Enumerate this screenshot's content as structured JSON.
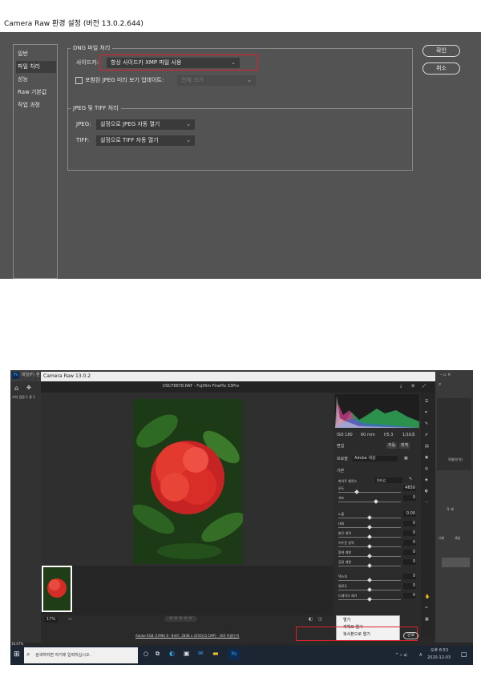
{
  "dialog": {
    "title": "Camera Raw 환경 설정  (버전 13.0.2.644)",
    "sidebar": [
      {
        "label": "일반",
        "selected": false
      },
      {
        "label": "파일 처리",
        "selected": true
      },
      {
        "label": "성능",
        "selected": false
      },
      {
        "label": "Raw 기본값",
        "selected": false
      },
      {
        "label": "작업 과정",
        "selected": false
      }
    ],
    "dng": {
      "group_title": "DNG 파일 처리",
      "sidecar_label": "사이드카:",
      "sidecar_value": "항상 사이드카 XMP 파일 사용",
      "embedded_label": "포함된 JPEG 미리 보기 업데이트:",
      "embedded_checked": false,
      "embedded_value": "전체 크기"
    },
    "jpeg_tiff": {
      "group_title": "JPEG 및 TIFF 처리",
      "jpeg_label": "JPEG:",
      "jpeg_value": "설정으로 JPEG 자동 열기",
      "tiff_label": "TIFF:",
      "tiff_value": "설정으로 TIFF 자동 열기"
    },
    "ok_label": "확인",
    "cancel_label": "취소",
    "highlight_color": "#e0202a"
  },
  "screenshot": {
    "ps_menu": {
      "logo": "Ps",
      "file_menu": "파일(F)",
      "edit_menu": "편"
    },
    "ps_doc_tab": "기저 검증-1 용 1",
    "cr_window_title": "Camera Raw 13.0.2",
    "file_name": "DSCF8878.RAF  -  Fujifilm FinePix S3Pro",
    "camera_info": {
      "iso": "ISO 180",
      "focal": "60 mm",
      "aperture": "f/5.3",
      "shutter": "1/16초"
    },
    "edit_label": "편집",
    "auto_label": "자동",
    "bw_label": "흑백",
    "profile_label": "프로필",
    "profile_value": "Adobe 색상",
    "basic_section": "기본",
    "wb_label": "화이트 밸런스",
    "wb_value": "원본값",
    "sliders": [
      {
        "label": "온도",
        "value": "4650",
        "pos": 0.3
      },
      {
        "label": "색조",
        "value": "0",
        "pos": 0.6
      },
      {
        "label": "노출",
        "value": "0.00",
        "pos": 0.5
      },
      {
        "label": "대비",
        "value": "0",
        "pos": 0.5
      },
      {
        "label": "밝은 영역",
        "value": "0",
        "pos": 0.5
      },
      {
        "label": "어두운 영역",
        "value": "0",
        "pos": 0.5
      },
      {
        "label": "흰색 계열",
        "value": "0",
        "pos": 0.5
      },
      {
        "label": "검정 계열",
        "value": "0",
        "pos": 0.5
      },
      {
        "label": "텍스처",
        "value": "0",
        "pos": 0.5
      },
      {
        "label": "명료도",
        "value": "0",
        "pos": 0.5
      },
      {
        "label": "디헤이즈 제거",
        "value": "0",
        "pos": 0.5
      }
    ],
    "zoom": "17%",
    "rating_stars": "☆ ☆ ☆ ☆ ☆",
    "workflow_link": "Adobe RGB (1998) 8 - 8비트, 2848 x 4256(12.1MP) - 300 픽셀/인치",
    "context_menu": [
      "열기",
      "개체로 열기",
      "복사본으로 열기"
    ],
    "done_label": "완료",
    "ps_zoom": "16.67%",
    "ps_right_labels": [
      "직렬(인치)",
      "각 레",
      "너비",
      "색상"
    ],
    "taskbar": {
      "search_placeholder": "검색하려면 여기에 입력하십시오.",
      "time": "오후 8:53",
      "date": "2020-12-03",
      "lang": "A"
    },
    "highlight_color": "#e0202a"
  }
}
